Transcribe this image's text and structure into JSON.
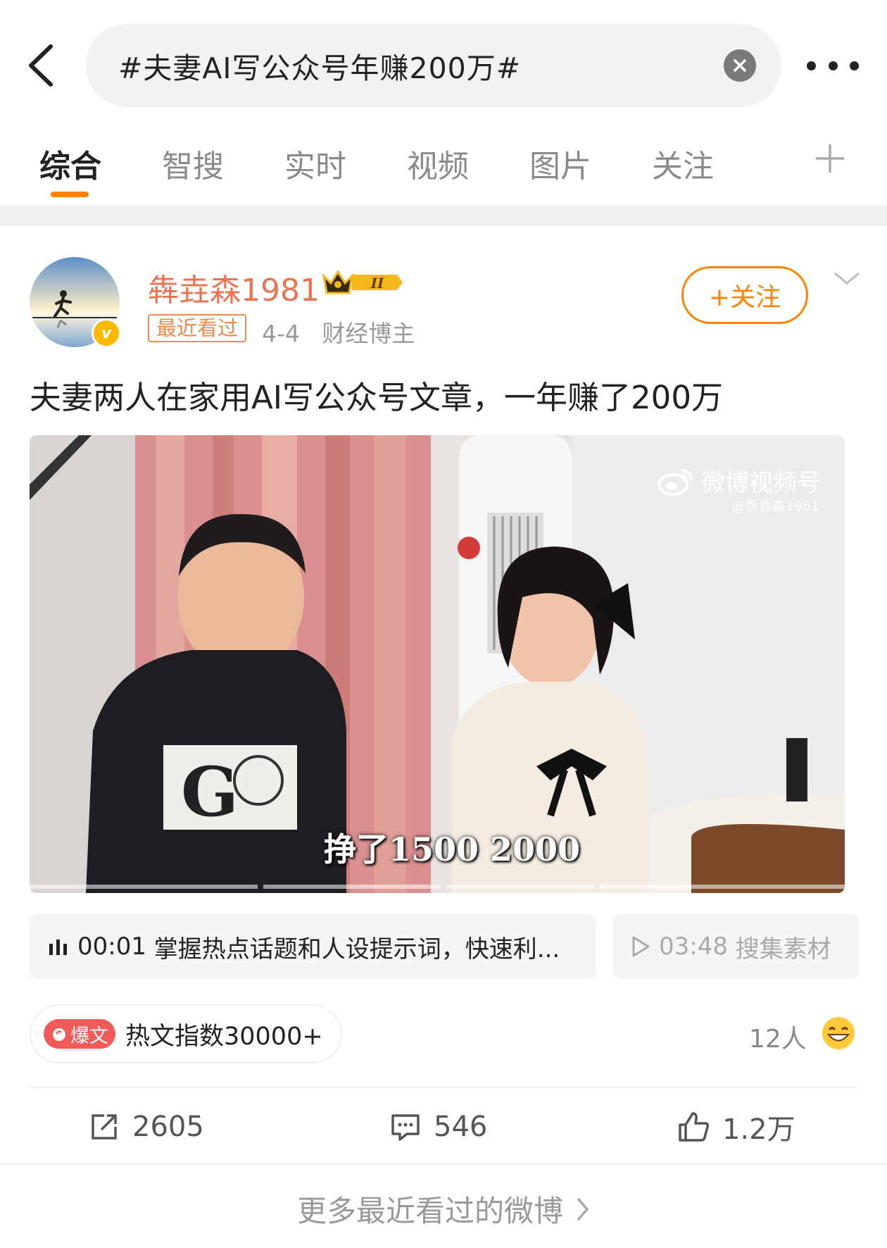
{
  "search": {
    "query": "#夫妻AI写公众号年赚200万#"
  },
  "tabs": [
    {
      "label": "综合",
      "active": true
    },
    {
      "label": "智搜"
    },
    {
      "label": "实时"
    },
    {
      "label": "视频"
    },
    {
      "label": "图片"
    },
    {
      "label": "关注"
    }
  ],
  "post": {
    "username": "犇垚森1981",
    "level_badge": "II",
    "recent_badge": "最近看过",
    "date": "4-4",
    "role": "财经博主",
    "follow_label": "+关注",
    "text": "夫妻两人在家用AI写公众号文章，一年赚了200万",
    "video": {
      "watermark_brand": "微博视频号",
      "watermark_user": "@犇垚森1981",
      "subtitle": "挣了1500 2000"
    },
    "chapters": [
      {
        "time": "00:01",
        "title": "掌握热点话题和人设提示词，快速利..."
      },
      {
        "time": "03:48",
        "title": "搜集素材"
      }
    ],
    "hot": {
      "badge": "爆文",
      "text": "热文指数30000+"
    },
    "reactions_people": "12人",
    "actions": {
      "repost": "2605",
      "comment": "546",
      "like": "1.2万"
    }
  },
  "more_link": "更多最近看过的微博",
  "colors": {
    "accent": "#ff8200",
    "username": "#eb7350",
    "hot": "#f25a5a"
  }
}
